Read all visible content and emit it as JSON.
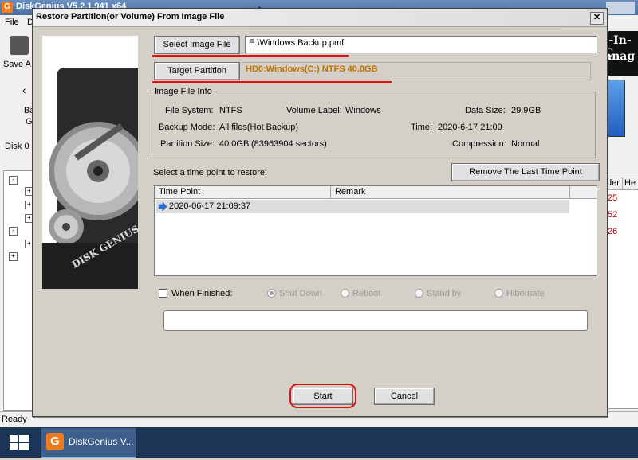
{
  "app": {
    "title": "DiskGenius V5.2.1.941 x64",
    "menu_file": "File",
    "menu_d": "D",
    "save_label": "Save A",
    "left_ba": "Ba",
    "left_g": "G",
    "disk_label": "Disk 0",
    "banner_line1": "l-In-C",
    "banner_line2": "anag",
    "col_der": "der",
    "col_he": "He",
    "row_values": [
      "25",
      "52",
      "26"
    ],
    "status": "Ready",
    "taskbar_app": "DiskGenius V..."
  },
  "dialog": {
    "title": "Restore Partition(or Volume) From Image File",
    "close": "✕",
    "select_image_label": "Select Image File",
    "image_path": "E:\\Windows Backup.pmf",
    "target_partition_label": "Target Partition",
    "target_value": "HD0:Windows(C:) NTFS 40.0GB",
    "info_group_title": "Image File Info",
    "info": {
      "fs_label": "File System:",
      "fs_value": "NTFS",
      "volume_label_label": "Volume Label:",
      "volume_label_value": "Windows",
      "data_size_label": "Data Size:",
      "data_size_value": "29.9GB",
      "backup_mode_label": "Backup Mode:",
      "backup_mode_value": "All files(Hot Backup)",
      "time_label": "Time:",
      "time_value": "2020-6-17 21:09",
      "partition_size_label": "Partition Size:",
      "partition_size_value": "40.0GB",
      "sectors_value": "(83963904 sectors)",
      "compression_label": "Compression:",
      "compression_value": "Normal"
    },
    "select_time_prompt": "Select a time point to restore:",
    "remove_last_label": "Remove The Last Time Point",
    "list_headers": [
      "Time Point",
      "Remark"
    ],
    "time_points": [
      {
        "time": "2020-06-17 21:09:37",
        "remark": ""
      }
    ],
    "when_finished_label": "When Finished:",
    "when_finished_checked": false,
    "options": [
      "Shut Down",
      "Reboot",
      "Stand by",
      "Hibernate"
    ],
    "start_label": "Start",
    "cancel_label": "Cancel",
    "disk_logo_text": "DISK GENIUS"
  },
  "colors": {
    "accent_red": "#e01010",
    "target_text": "#c07000"
  }
}
